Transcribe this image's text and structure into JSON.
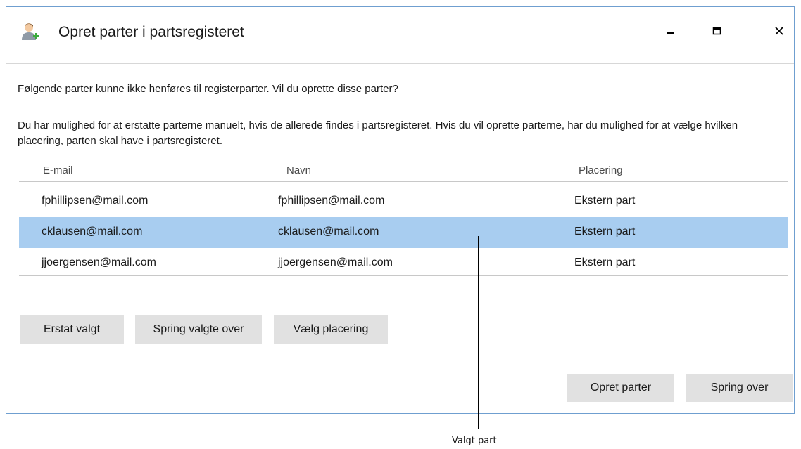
{
  "window": {
    "title": "Opret parter i partsregisteret",
    "icon": "person-add-icon",
    "controls": {
      "minimize": "minimize-icon",
      "maximize": "maximize-icon",
      "close": "close-icon"
    }
  },
  "message": {
    "line1": "Følgende parter kunne ikke henføres til registerparter. Vil du oprette disse parter?",
    "line2": "Du har mulighed for at erstatte parterne manuelt, hvis de allerede findes i partsregisteret. Hvis du vil oprette parterne, har du mulighed for at vælge hvilken placering, parten skal have i partsregisteret."
  },
  "table": {
    "columns": [
      "E-mail",
      "Navn",
      "Placering"
    ],
    "rows": [
      {
        "email": "fphillipsen@mail.com",
        "name": "fphillipsen@mail.com",
        "placement": "Ekstern part",
        "selected": false
      },
      {
        "email": "cklausen@mail.com",
        "name": "cklausen@mail.com",
        "placement": "Ekstern part",
        "selected": true
      },
      {
        "email": "jjoergensen@mail.com",
        "name": "jjoergensen@mail.com",
        "placement": "Ekstern part",
        "selected": false
      }
    ],
    "selected_color": "#a8cdf0"
  },
  "actions": {
    "replace": "Erstat valgt",
    "skip_selected": "Spring valgte over",
    "choose_placement": "Vælg placering",
    "create": "Opret parter",
    "skip": "Spring over"
  },
  "callout": {
    "label": "Valgt part"
  },
  "colors": {
    "window_border": "#6f9fd0",
    "button_bg": "#e1e1e1"
  }
}
